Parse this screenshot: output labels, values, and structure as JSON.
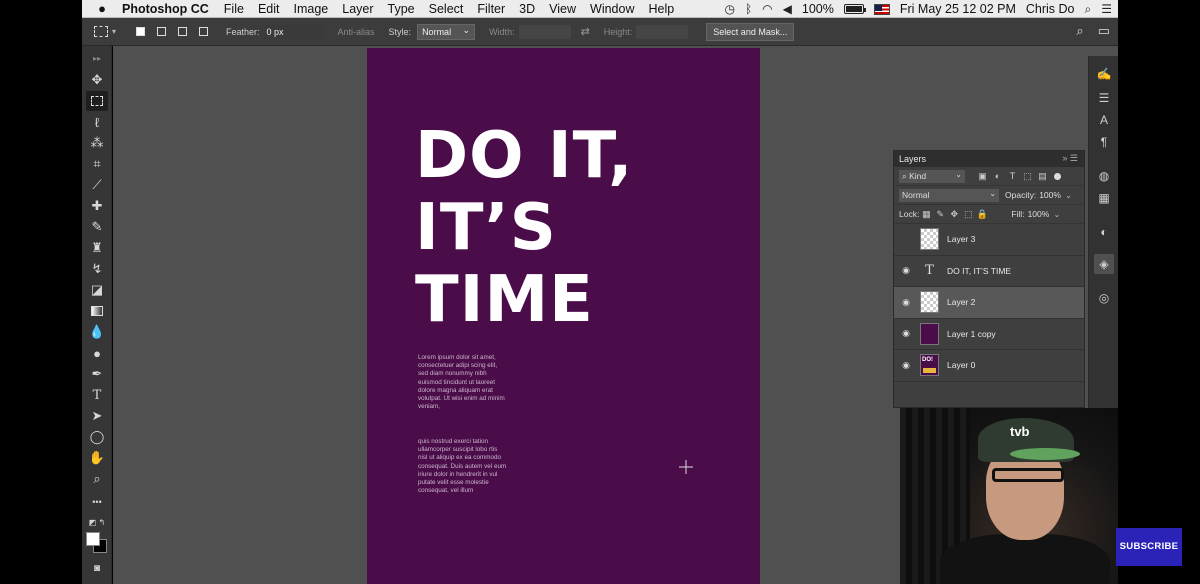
{
  "menubar": {
    "app_name": "Photoshop CC",
    "items": [
      "File",
      "Edit",
      "Image",
      "Layer",
      "Type",
      "Select",
      "Filter",
      "3D",
      "View",
      "Window",
      "Help"
    ],
    "battery": "100%",
    "datetime": "Fri May 25  12 02 PM",
    "user": "Chris Do"
  },
  "options_bar": {
    "feather_label": "Feather:",
    "feather_value": "0 px",
    "antialias_label": "Anti-alias",
    "style_label": "Style:",
    "style_value": "Normal",
    "width_label": "Width:",
    "height_label": "Height:",
    "select_mask_label": "Select and Mask..."
  },
  "document": {
    "headline": [
      "DO IT,",
      "IT’S",
      "TIME"
    ],
    "body_paragraph_1": "Lorem ipsum dolor sit amet, consectetuer adipi scing elit, sed diam nonummy nibh euismod tincidunt ut laoreet dolore magna aliquam erat volutpat. Ut wisi enim ad minim veniam,",
    "body_paragraph_2": "quis nostrud exerci tation ullamcorper suscipit lobo rtis nisl ut aliquip ex ea commodo consequat. Duis autem vel eum iriure dolor in hendrerit in vul putate velit esse molestie consequat, vel illum",
    "background_color": "#4b0c4a"
  },
  "layers_panel": {
    "title": "Layers",
    "filter_kind": "Kind",
    "blend_mode": "Normal",
    "opacity_label": "Opacity:",
    "opacity_value": "100%",
    "lock_label": "Lock:",
    "fill_label": "Fill:",
    "fill_value": "100%",
    "layers": [
      {
        "name": "Layer 3",
        "visible": false,
        "selected": false
      },
      {
        "name": "DO IT, IT’S TIME",
        "visible": true,
        "selected": false
      },
      {
        "name": "Layer 2",
        "visible": true,
        "selected": true
      },
      {
        "name": "Layer 1 copy",
        "visible": true,
        "selected": false
      },
      {
        "name": "Layer 0",
        "visible": true,
        "selected": false
      }
    ]
  },
  "webcam": {
    "cap_text": "tvb"
  },
  "subscribe": {
    "label": "SUBSCRIBE",
    "color": "#2b23b8"
  }
}
